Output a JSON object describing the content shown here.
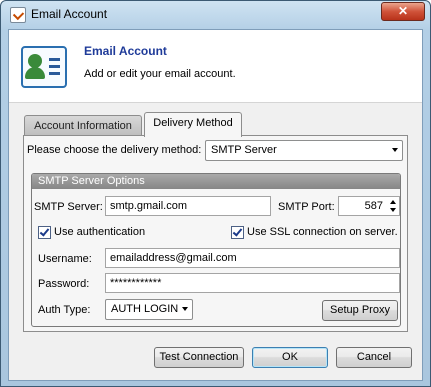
{
  "window": {
    "title": "Email Account",
    "close_glyph": "✕"
  },
  "header": {
    "title": "Email Account",
    "subtitle": "Add or edit your email account.",
    "icon": "contact-card-icon"
  },
  "tabs": [
    {
      "label": "Account Information",
      "selected": false
    },
    {
      "label": "Delivery Method",
      "selected": true
    }
  ],
  "delivery": {
    "label": "Please choose the delivery method:",
    "value": "SMTP Server"
  },
  "smtp": {
    "group_title": "SMTP Server Options",
    "server_label": "SMTP Server:",
    "server_value": "smtp.gmail.com",
    "port_label": "SMTP Port:",
    "port_value": "587",
    "use_auth_label": "Use authentication",
    "use_auth_checked": true,
    "use_ssl_label": "Use SSL connection on server.",
    "use_ssl_checked": true,
    "username_label": "Username:",
    "username_value": "emailaddress@gmail.com",
    "password_label": "Password:",
    "password_value": "************",
    "auth_type_label": "Auth Type:",
    "auth_type_value": "AUTH LOGIN",
    "setup_proxy_label": "Setup Proxy"
  },
  "buttons": {
    "test_connection": "Test Connection",
    "ok": "OK",
    "cancel": "Cancel"
  }
}
